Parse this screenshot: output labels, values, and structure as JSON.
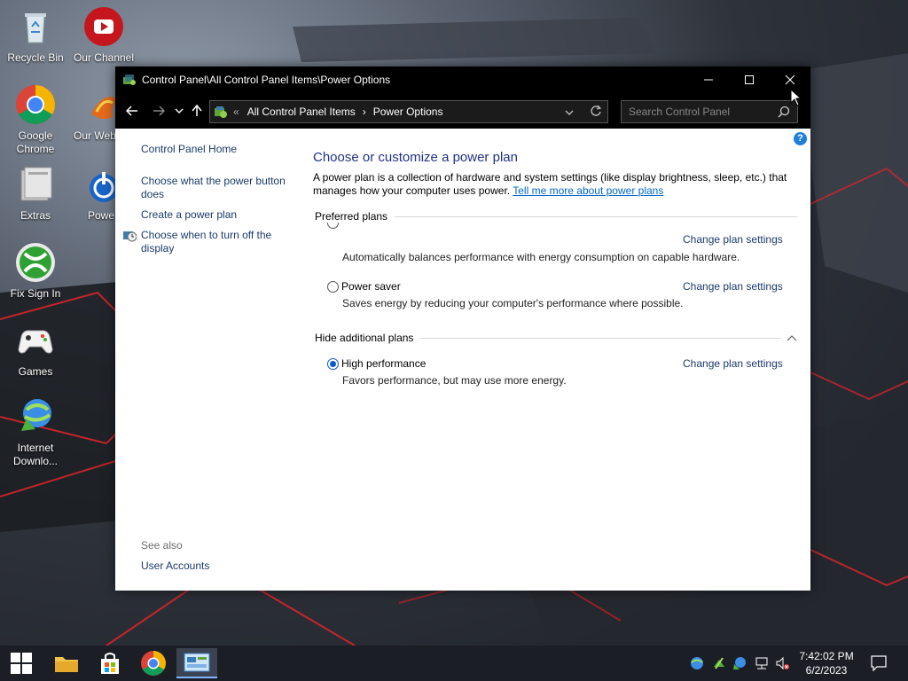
{
  "desktop": {
    "icons": [
      {
        "label": "Recycle Bin",
        "icon": "recycle-bin-icon"
      },
      {
        "label": "Our Channel",
        "icon": "youtube-icon"
      },
      {
        "label": "Google Chrome",
        "icon": "chrome-icon"
      },
      {
        "label": "Our Web",
        "icon": "web-icon"
      },
      {
        "label": "Extras",
        "icon": "folder-icon"
      },
      {
        "label": "Powe",
        "icon": "power-icon"
      },
      {
        "label": "Fix Sign In",
        "icon": "xbox-icon"
      },
      {
        "label": "Games",
        "icon": "gamepad-icon"
      },
      {
        "label": "Internet Downlo...",
        "icon": "idm-icon"
      }
    ]
  },
  "window": {
    "title": "Control Panel\\All Control Panel Items\\Power Options",
    "breadcrumb": {
      "overflow": "«",
      "item1": "All Control Panel Items",
      "separator": "›",
      "item2": "Power Options"
    },
    "search_placeholder": "Search Control Panel",
    "help": "?"
  },
  "left_pane": {
    "home": "Control Panel Home",
    "links": [
      "Choose what the power button does",
      "Create a power plan",
      "Choose when to turn off the display"
    ],
    "see_also": "See also",
    "see_also_links": [
      "User Accounts"
    ]
  },
  "main": {
    "heading": "Choose or customize a power plan",
    "description": "A power plan is a collection of hardware and system settings (like display brightness, sleep, etc.) that manages how your computer uses power.",
    "description_link": "Tell me more about power plans",
    "preferred_header": "Preferred plans",
    "hidden_header": "Hide additional plans",
    "change_label": "Change plan settings",
    "plans": [
      {
        "name": "",
        "desc": "Automatically balances performance with energy consumption on capable hardware.",
        "selected": false
      },
      {
        "name": "Power saver",
        "desc": "Saves energy by reducing your computer's performance where possible.",
        "selected": false
      },
      {
        "name": "High performance",
        "desc": "Favors performance, but may use more energy.",
        "selected": true
      }
    ]
  },
  "taskbar": {
    "time": "7:42:02 PM",
    "date": "6/2/2023"
  },
  "colors": {
    "accent": "#0a58c9",
    "heading": "#1e3287",
    "link": "#0066cc"
  }
}
